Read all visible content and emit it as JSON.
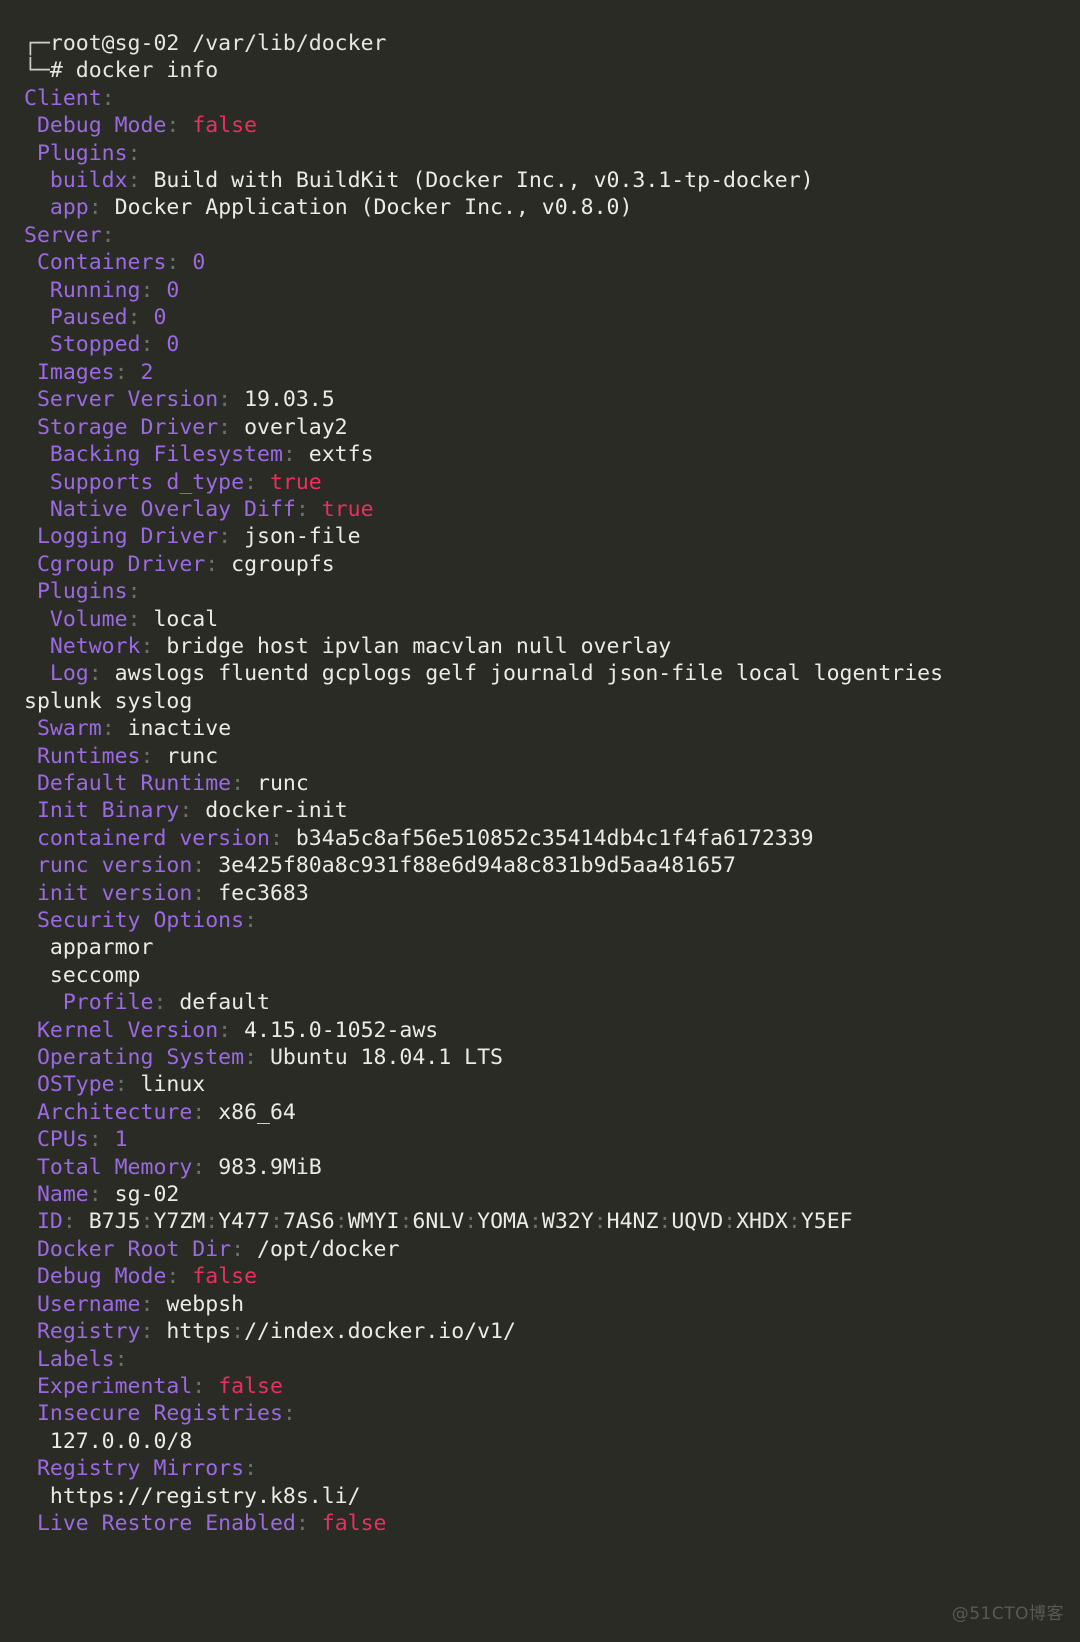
{
  "terminal": {
    "background_color": "#2b2b26",
    "key_color": "#9a6ae1",
    "value_color": "#ebebe4",
    "boolean_color": "#e8305f",
    "colon_color": "#6f6f69",
    "watermark": "@51CTO博客"
  },
  "prompt": {
    "top_glyph": "┌─",
    "bottom_glyph": "└─",
    "user_host": "root@sg-02",
    "cwd": "/var/lib/docker",
    "symbol": "#",
    "command": "docker info"
  },
  "lines": [
    {
      "indent": 0,
      "key": "Client",
      "colon": ":",
      "value": "",
      "type": "none"
    },
    {
      "indent": 1,
      "key": "Debug Mode",
      "colon": ":",
      "value": "false",
      "type": "bool"
    },
    {
      "indent": 1,
      "key": "Plugins",
      "colon": ":",
      "value": "",
      "type": "none"
    },
    {
      "indent": 2,
      "key": "buildx",
      "colon": ":",
      "value": "Build with BuildKit (Docker Inc., v0.3.1-tp-docker)",
      "type": "str"
    },
    {
      "indent": 2,
      "key": "app",
      "colon": ":",
      "value": "Docker Application (Docker Inc., v0.8.0)",
      "type": "str"
    },
    {
      "indent": 0,
      "key": "Server",
      "colon": ":",
      "value": "",
      "type": "none"
    },
    {
      "indent": 1,
      "key": "Containers",
      "colon": ":",
      "value": "0",
      "type": "num"
    },
    {
      "indent": 2,
      "key": "Running",
      "colon": ":",
      "value": "0",
      "type": "num"
    },
    {
      "indent": 2,
      "key": "Paused",
      "colon": ":",
      "value": "0",
      "type": "num"
    },
    {
      "indent": 2,
      "key": "Stopped",
      "colon": ":",
      "value": "0",
      "type": "num"
    },
    {
      "indent": 1,
      "key": "Images",
      "colon": ":",
      "value": "2",
      "type": "num"
    },
    {
      "indent": 1,
      "key": "Server Version",
      "colon": ":",
      "value": "19.03.5",
      "type": "str"
    },
    {
      "indent": 1,
      "key": "Storage Driver",
      "colon": ":",
      "value": "overlay2",
      "type": "str"
    },
    {
      "indent": 2,
      "key": "Backing Filesystem",
      "colon": ":",
      "value": "extfs",
      "type": "str"
    },
    {
      "indent": 2,
      "key": "Supports d_type",
      "colon": ":",
      "value": "true",
      "type": "bool"
    },
    {
      "indent": 2,
      "key": "Native Overlay Diff",
      "colon": ":",
      "value": "true",
      "type": "bool"
    },
    {
      "indent": 1,
      "key": "Logging Driver",
      "colon": ":",
      "value": "json-file",
      "type": "str"
    },
    {
      "indent": 1,
      "key": "Cgroup Driver",
      "colon": ":",
      "value": "cgroupfs",
      "type": "str"
    },
    {
      "indent": 1,
      "key": "Plugins",
      "colon": ":",
      "value": "",
      "type": "none"
    },
    {
      "indent": 2,
      "key": "Volume",
      "colon": ":",
      "value": "local",
      "type": "str"
    },
    {
      "indent": 2,
      "key": "Network",
      "colon": ":",
      "value": "bridge host ipvlan macvlan null overlay",
      "type": "str"
    },
    {
      "indent": 2,
      "key": "Log",
      "colon": ":",
      "value": "awslogs fluentd gcplogs gelf journald json-file local logentries",
      "type": "str",
      "wrap_tail": "splunk syslog"
    },
    {
      "indent": 1,
      "key": "Swarm",
      "colon": ":",
      "value": "inactive",
      "type": "str"
    },
    {
      "indent": 1,
      "key": "Runtimes",
      "colon": ":",
      "value": "runc",
      "type": "str"
    },
    {
      "indent": 1,
      "key": "Default Runtime",
      "colon": ":",
      "value": "runc",
      "type": "str"
    },
    {
      "indent": 1,
      "key": "Init Binary",
      "colon": ":",
      "value": "docker-init",
      "type": "str"
    },
    {
      "indent": 1,
      "key": "containerd version",
      "colon": ":",
      "value": "b34a5c8af56e510852c35414db4c1f4fa6172339",
      "type": "str"
    },
    {
      "indent": 1,
      "key": "runc version",
      "colon": ":",
      "value": "3e425f80a8c931f88e6d94a8c831b9d5aa481657",
      "type": "str"
    },
    {
      "indent": 1,
      "key": "init version",
      "colon": ":",
      "value": "fec3683",
      "type": "str"
    },
    {
      "indent": 1,
      "key": "Security Options",
      "colon": ":",
      "value": "",
      "type": "none"
    },
    {
      "indent": 2,
      "key": "",
      "colon": "",
      "value": "apparmor",
      "type": "plain"
    },
    {
      "indent": 2,
      "key": "",
      "colon": "",
      "value": "seccomp",
      "type": "plain"
    },
    {
      "indent": 3,
      "key": "Profile",
      "colon": ":",
      "value": "default",
      "type": "str"
    },
    {
      "indent": 1,
      "key": "Kernel Version",
      "colon": ":",
      "value": "4.15.0-1052-aws",
      "type": "str"
    },
    {
      "indent": 1,
      "key": "Operating System",
      "colon": ":",
      "value": "Ubuntu 18.04.1 LTS",
      "type": "str"
    },
    {
      "indent": 1,
      "key": "OSType",
      "colon": ":",
      "value": "linux",
      "type": "str"
    },
    {
      "indent": 1,
      "key": "Architecture",
      "colon": ":",
      "value": "x86_64",
      "type": "str"
    },
    {
      "indent": 1,
      "key": "CPUs",
      "colon": ":",
      "value": "1",
      "type": "num"
    },
    {
      "indent": 1,
      "key": "Total Memory",
      "colon": ":",
      "value": "983.9MiB",
      "type": "str"
    },
    {
      "indent": 1,
      "key": "Name",
      "colon": ":",
      "value": "sg-02",
      "type": "str"
    },
    {
      "indent": 1,
      "key": "ID",
      "colon": ":",
      "value": "B7J5:Y7ZM:Y477:7AS6:WMYI:6NLV:YOMA:W32Y:H4NZ:UQVD:XHDX:Y5EF",
      "type": "id"
    },
    {
      "indent": 1,
      "key": "Docker Root Dir",
      "colon": ":",
      "value": "/opt/docker",
      "type": "str"
    },
    {
      "indent": 1,
      "key": "Debug Mode",
      "colon": ":",
      "value": "false",
      "type": "bool"
    },
    {
      "indent": 1,
      "key": "Username",
      "colon": ":",
      "value": "webpsh",
      "type": "str"
    },
    {
      "indent": 1,
      "key": "Registry",
      "colon": ":",
      "value": "https://index.docker.io/v1/",
      "type": "url"
    },
    {
      "indent": 1,
      "key": "Labels",
      "colon": ":",
      "value": "",
      "type": "none"
    },
    {
      "indent": 1,
      "key": "Experimental",
      "colon": ":",
      "value": "false",
      "type": "bool"
    },
    {
      "indent": 1,
      "key": "Insecure Registries",
      "colon": ":",
      "value": "",
      "type": "none"
    },
    {
      "indent": 2,
      "key": "",
      "colon": "",
      "value": "127.0.0.0/8",
      "type": "plain"
    },
    {
      "indent": 1,
      "key": "Registry Mirrors",
      "colon": ":",
      "value": "",
      "type": "none"
    },
    {
      "indent": 2,
      "key": "",
      "colon": "",
      "value": "https://registry.k8s.li/",
      "type": "plain"
    },
    {
      "indent": 1,
      "key": "Live Restore Enabled",
      "colon": ":",
      "value": "false",
      "type": "bool"
    }
  ]
}
